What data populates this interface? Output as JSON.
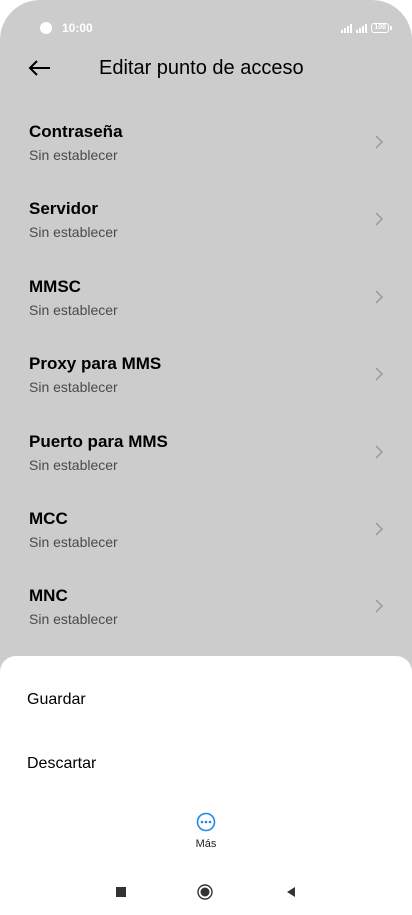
{
  "status_bar": {
    "time": "10:00",
    "battery": "100"
  },
  "header": {
    "title": "Editar punto de acceso",
    "back_icon": "arrow-left-icon"
  },
  "settings": [
    {
      "title": "Contraseña",
      "value": "Sin establecer"
    },
    {
      "title": "Servidor",
      "value": "Sin establecer"
    },
    {
      "title": "MMSC",
      "value": "Sin establecer"
    },
    {
      "title": "Proxy para MMS",
      "value": "Sin establecer"
    },
    {
      "title": "Puerto para MMS",
      "value": "Sin establecer"
    },
    {
      "title": "MCC",
      "value": "Sin establecer"
    },
    {
      "title": "MNC",
      "value": "Sin establecer"
    }
  ],
  "sheet": {
    "save_label": "Guardar",
    "discard_label": "Descartar",
    "more_label": "Más",
    "more_icon": "more-horizontal-circle-icon"
  },
  "colors": {
    "dimmed_background": "#cccccc",
    "sheet_background": "#ffffff",
    "accent": "#1e88e5",
    "chevron": "#999999"
  }
}
